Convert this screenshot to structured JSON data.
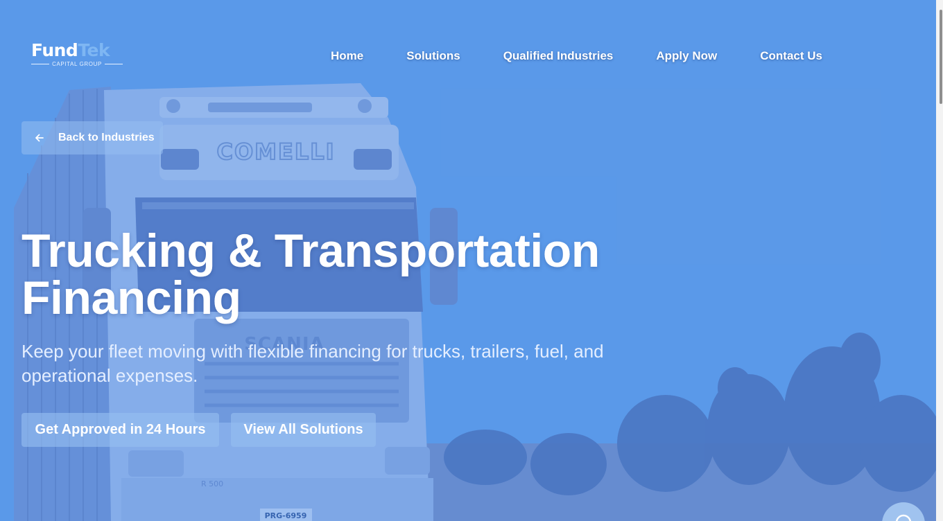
{
  "brand": {
    "logo_word_1": "Fund",
    "logo_word_2": "Tek",
    "logo_tagline": "CAPITAL GROUP",
    "accent_color": "#7eb6f3"
  },
  "nav": {
    "items": [
      {
        "label": "Home"
      },
      {
        "label": "Solutions"
      },
      {
        "label": "Qualified Industries"
      },
      {
        "label": "Apply Now"
      },
      {
        "label": "Contact Us"
      }
    ]
  },
  "back_button": {
    "label": "Back to Industries",
    "icon": "arrow-left-icon"
  },
  "hero": {
    "title": "Trucking & Transportation Financing",
    "subtitle": "Keep your fleet moving with flexible financing for trucks, trailers, fuel, and operational expenses.",
    "primary_cta": "Get Approved in 24 Hours",
    "secondary_cta": "View All Solutions",
    "background_color": "#4a8ce6"
  },
  "truck": {
    "brand_on_cab": "COMELLI",
    "grille_badge": "SCANIA",
    "bumper_badge": "R 500",
    "plate": "PRG-6959"
  },
  "chat": {
    "icon": "chat-icon"
  }
}
